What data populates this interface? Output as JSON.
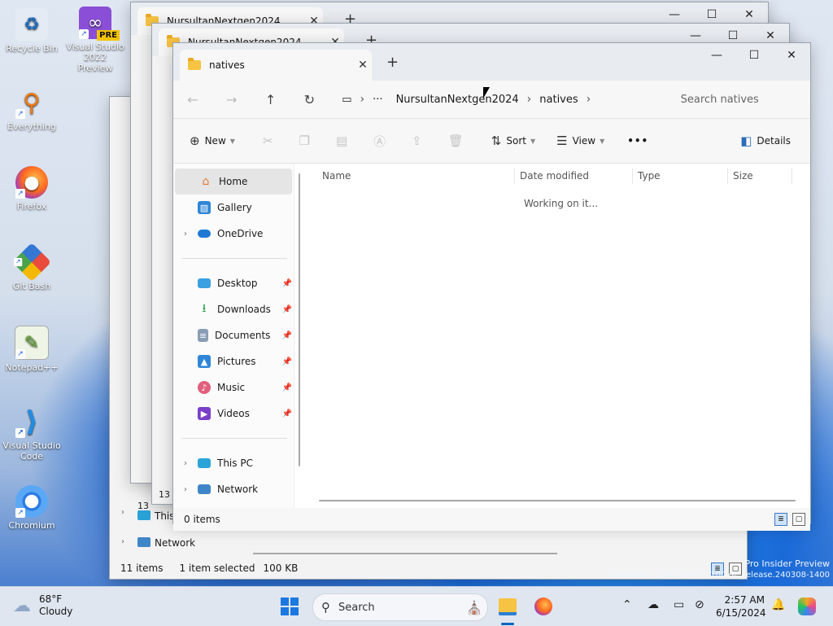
{
  "desktop": {
    "icons": [
      {
        "label": "Recycle Bin",
        "icon": "recycle-bin-icon"
      },
      {
        "label": "Visual Studio 2022 Preview",
        "badge": "PRE",
        "icon": "visual-studio-icon"
      },
      {
        "label": "Everything",
        "icon": "everything-search-icon"
      },
      {
        "label": "Firefox",
        "icon": "firefox-icon"
      },
      {
        "label": "Git Bash",
        "icon": "git-bash-icon"
      },
      {
        "label": "Notepad++",
        "icon": "notepadpp-icon"
      },
      {
        "label": "Visual Studio Code",
        "icon": "vscode-icon"
      },
      {
        "label": "Chromium",
        "icon": "chromium-icon"
      }
    ],
    "watermark_line1": "Pro Insider Preview",
    "watermark_line2": "Evaluation copy. Build 26100.ge_release.240308-1400"
  },
  "back_windows": {
    "tab_title": "NursultanNextgen2024",
    "w3": {
      "nav_this_pc": "This PC",
      "nav_network": "Network",
      "status_items": "11 items",
      "status_selected": "1 item selected",
      "status_size": "100 KB",
      "count_fragment": "13"
    }
  },
  "main_window": {
    "tab_title": "natives",
    "breadcrumb": [
      "NursultanNextgen2024",
      "natives"
    ],
    "search_placeholder": "Search natives",
    "toolbar": {
      "new_label": "New",
      "sort_label": "Sort",
      "view_label": "View",
      "more_label": "•••",
      "details_label": "Details"
    },
    "nav": {
      "home": "Home",
      "gallery": "Gallery",
      "onedrive": "OneDrive",
      "desktop": "Desktop",
      "downloads": "Downloads",
      "documents": "Documents",
      "pictures": "Pictures",
      "music": "Music",
      "videos": "Videos",
      "this_pc": "This PC",
      "network": "Network"
    },
    "columns": [
      "Name",
      "Date modified",
      "Type",
      "Size"
    ],
    "loading_text": "Working on it...",
    "status_text": "0 items"
  },
  "taskbar": {
    "weather_temp": "68°F",
    "weather_desc": "Cloudy",
    "search_label": "Search",
    "time": "2:57 AM",
    "date": "6/15/2024"
  },
  "colors": {
    "accent": "#0067c0",
    "folder": "#f6c343"
  }
}
